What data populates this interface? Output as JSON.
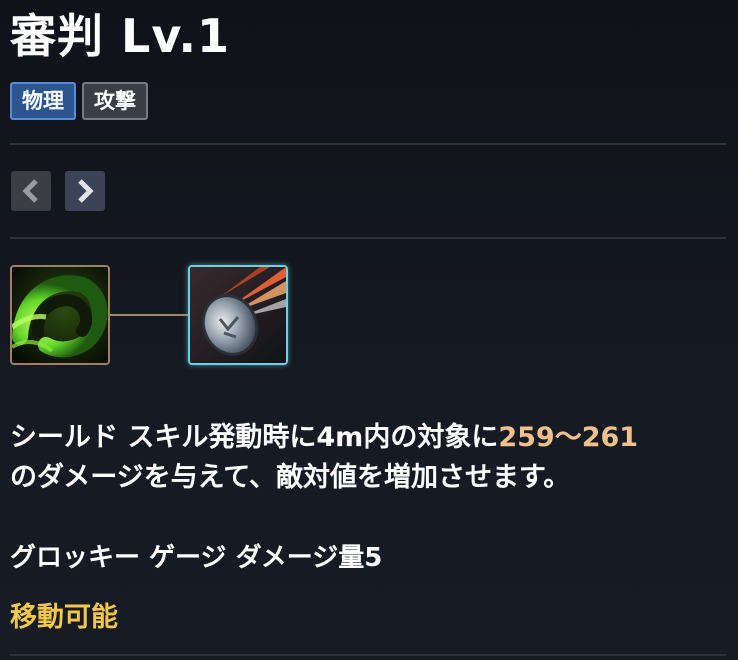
{
  "skill": {
    "title": "審判 Lv.1",
    "tags": [
      "物理",
      "攻撃"
    ]
  },
  "icons": {
    "prev": "chevron-left-icon",
    "next": "chevron-right-icon",
    "skill_a": "green-vortex-skill-icon",
    "skill_b": "flaming-shield-skill-icon"
  },
  "description": {
    "part1": "シールド スキル発動時に4m内の対象に",
    "damage_range": "259～261",
    "part2": "のダメージを与えて、敵対値を増加させます。"
  },
  "groggy": "グロッキー ゲージ ダメージ量5",
  "movable": "移動可能",
  "colors": {
    "highlight": "#f2c08a",
    "movable": "#f5c84a",
    "tag_physical": "#2a5590",
    "tag_attack": "#3a3e45"
  }
}
